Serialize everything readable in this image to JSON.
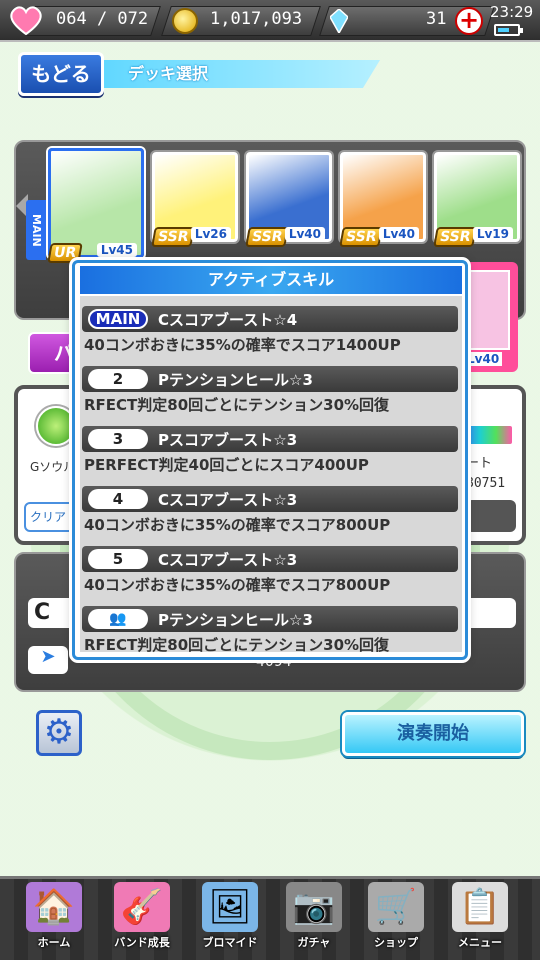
{
  "status": {
    "stamina": "064 / 072",
    "coins": "1,017,093",
    "gems": "31",
    "time": "23:29",
    "battery_fill": 0.6
  },
  "nav": {
    "back_label": "もどる",
    "screen_title": "デッキ選択"
  },
  "deck": {
    "main_tag": "MAIN",
    "cards": [
      {
        "rarity": "UR",
        "level": "Lv45",
        "bg": "#b7e6a8"
      },
      {
        "rarity": "SSR",
        "level": "Lv26",
        "bg": "#fff27a"
      },
      {
        "rarity": "SSR",
        "level": "Lv40",
        "bg": "#3a6fd0"
      },
      {
        "rarity": "SSR",
        "level": "Lv40",
        "bg": "#f5a24a"
      },
      {
        "rarity": "SSR",
        "level": "Lv19",
        "bg": "#9ede8a"
      }
    ],
    "hidden_card_level": "Lv40"
  },
  "under": {
    "pink_button_label": "パ",
    "g_label": "Gソウル",
    "clear_label": "クリア",
    "right_text1": "ート",
    "right_text2": "80751",
    "lower_number": "4094"
  },
  "popup": {
    "title": "アクティブスキル",
    "skills": [
      {
        "badge": "MAIN",
        "name": "Cスコアブースト☆4",
        "desc": "40コンボおきに35%の確率でスコア1400UP"
      },
      {
        "badge": "2",
        "name": "Pテンションヒール☆3",
        "desc": "RFECT判定80回ごとにテンション30%回復"
      },
      {
        "badge": "3",
        "name": "Pスコアブースト☆3",
        "desc": "PERFECT判定40回ごとにスコア400UP"
      },
      {
        "badge": "4",
        "name": "Cスコアブースト☆3",
        "desc": "40コンボおきに35%の確率でスコア800UP"
      },
      {
        "badge": "5",
        "name": "Cスコアブースト☆3",
        "desc": "40コンボおきに35%の確率でスコア800UP"
      },
      {
        "badge": "👥",
        "name": "Pテンションヒール☆3",
        "desc": "RFECT判定80回ごとにテンション30%回復"
      }
    ]
  },
  "actions": {
    "start_label": "演奏開始"
  },
  "bottom_nav": [
    {
      "label": "ホーム",
      "icon": "home-icon",
      "glyph": "🏠"
    },
    {
      "label": "バンド成長",
      "icon": "guitar-heart-icon",
      "glyph": "🎸"
    },
    {
      "label": "ブロマイド",
      "icon": "photo-card-icon",
      "glyph": "🖼"
    },
    {
      "label": "ガチャ",
      "icon": "camera-icon",
      "glyph": "📷"
    },
    {
      "label": "ショップ",
      "icon": "cart-icon",
      "glyph": "🛒"
    },
    {
      "label": "メニュー",
      "icon": "menu-icon",
      "glyph": "📋"
    }
  ]
}
